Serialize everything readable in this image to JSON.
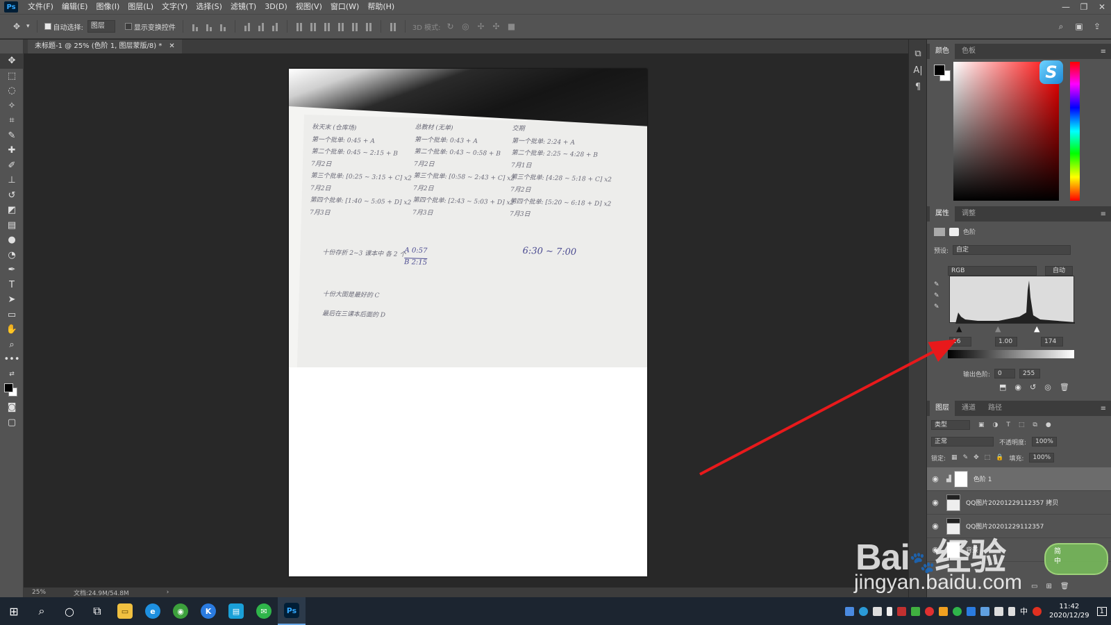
{
  "menu": {
    "items": [
      "文件(F)",
      "编辑(E)",
      "图像(I)",
      "图层(L)",
      "文字(Y)",
      "选择(S)",
      "滤镜(T)",
      "3D(D)",
      "视图(V)",
      "窗口(W)",
      "帮助(H)"
    ],
    "app_logo": "Ps"
  },
  "options": {
    "auto_select_label": "自动选择:",
    "auto_select_value": "图层",
    "show_transform_label": "显示变换控件",
    "mode_3d_label": "3D 模式:"
  },
  "document": {
    "tab_title": "未标题-1 @ 25% (色阶 1, 图层蒙版/8) *",
    "zoom": "25%",
    "doc_info": "文档:24.9M/54.8M"
  },
  "photo_text": {
    "col1": [
      "秋天末 (仓库场)",
      "第一个批单: 0:45 + A",
      "第二个批单: 0:45 ~ 2:15 + B",
      "7月2日",
      "第三个批单: [0:25 ~ 3:15 + C] x2",
      "7月2日",
      "第四个批单: [1:40 ~ 5:05 + D] x2",
      "7月3日"
    ],
    "col2": [
      "总教材 (无单)",
      "第一个批单: 0:43 + A",
      "第二个批单: 0:43 ~ 0:58 + B",
      "7月2日",
      "第三个批单: [0:58 ~ 2:43 + C] x2",
      "7月2日",
      "第四个批单: [2:43 ~ 5:03 + D] x2",
      "7月3日"
    ],
    "col3": [
      "交期",
      "第一个批单: 2:24 + A",
      "第二个批单: 2:25 ~ 4:28 + B",
      "7月1日",
      "第三个批单: [4:28 ~ 5:18 + C] x2",
      "7月2日",
      "第四个批单: [5:20 ~ 6:18 + D] x2",
      "7月3日"
    ],
    "note1": "十份存折 2~3 课本中 各 2 个",
    "note1_a": "A 0:57",
    "note1_b": "B 2:15",
    "note_time": "6:30 ~ 7:00",
    "note2": "十份大图是最好的 C",
    "note3": "最后在三课本后面的 D"
  },
  "color_panel": {
    "tabs": [
      "颜色",
      "色板"
    ],
    "badge_letter": "S",
    "foreground": "#000000",
    "background": "#ffffff"
  },
  "properties": {
    "tabs": [
      "属性",
      "调整"
    ],
    "adj_name": "色阶",
    "preset_label": "预设:",
    "preset_value": "自定",
    "channel": "RGB",
    "auto_label": "自动",
    "input_black": "16",
    "input_gamma": "1.00",
    "input_white": "174",
    "output_label": "输出色阶:",
    "output_black": "0",
    "output_white": "255"
  },
  "layers": {
    "tabs": [
      "图层",
      "通道",
      "路径"
    ],
    "filter_kind": "类型",
    "blend_mode": "正常",
    "opacity_label": "不透明度:",
    "opacity_value": "100%",
    "lock_label": "锁定:",
    "fill_label": "填充:",
    "fill_value": "100%",
    "items": [
      {
        "name": "色阶 1",
        "selected": true
      },
      {
        "name": "QQ图片20201229112357 拷贝",
        "selected": false
      },
      {
        "name": "QQ图片20201229112357",
        "selected": false
      },
      {
        "name": "背景",
        "selected": false
      }
    ]
  },
  "taskbar": {
    "time": "11:42",
    "date": "2020/12/29",
    "ime_lang": "中",
    "notification_count": "1"
  },
  "watermark": {
    "brand": "Bai",
    "brand_cn": "经验",
    "url": "jingyan.baidu.com",
    "ime_badge_top": "简",
    "ime_badge_bottom": "中"
  },
  "annotation_color": "#e8191b"
}
